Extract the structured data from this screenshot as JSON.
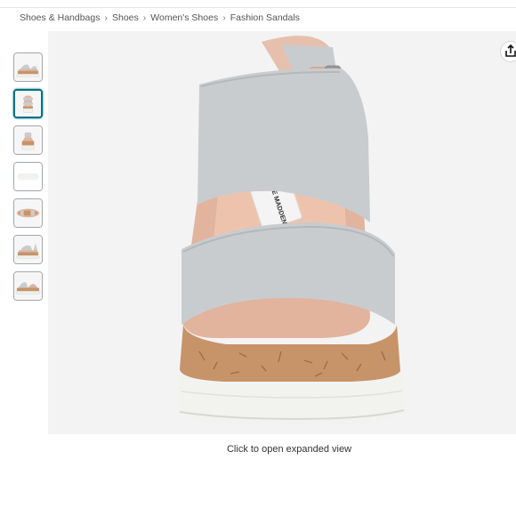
{
  "breadcrumb": [
    {
      "label": "Shoes & Handbags"
    },
    {
      "label": "Shoes"
    },
    {
      "label": "Women's Shoes"
    },
    {
      "label": "Fashion Sandals"
    }
  ],
  "breadcrumb_separator": "›",
  "thumbnails": [
    {
      "view": "side",
      "selected": false
    },
    {
      "view": "front",
      "selected": true
    },
    {
      "view": "back",
      "selected": false
    },
    {
      "view": "top",
      "selected": false
    },
    {
      "view": "sole",
      "selected": false
    },
    {
      "view": "side-alt",
      "selected": false
    },
    {
      "view": "pair",
      "selected": false
    }
  ],
  "main_image": {
    "insole_brand_text": "STEVE MADDEN"
  },
  "caption": "Click to open expanded view",
  "icons": {
    "share": "share-icon"
  },
  "colors": {
    "strap": "#c9ccce",
    "footbed": "#e2b39d",
    "cork": "#c79369",
    "sole": "#f2f2ee",
    "selected_border": "#007185"
  }
}
